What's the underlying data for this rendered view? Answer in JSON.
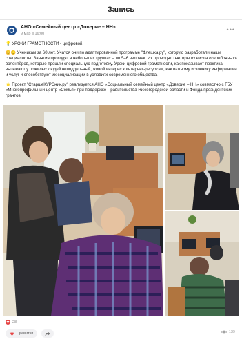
{
  "topbar": {
    "title": "Запись"
  },
  "post": {
    "org_name": "АНО «Семейный центр «Доверие – НН»",
    "date": "9 мар в 16:00",
    "heading": "УРОКИ ГРАМОТНОСТИ - цифровой.",
    "paragraph1": "Ученикам за 60 лет. Учатся они по адаптированной программе \"Флешка.ру\", которую разработали наши специалисты. Занятия проходят в небольших группах – по 5–6 человек. Их проводят тьюторы из числа «серебряных» волонтёров, которые прошли специальную подготовку. Уроки цифровой грамотности, как показывает практика, вызывают у пожилых людей неподдельный, живой интерес к интернет-ресурсам, как важному источнику информации и услуг и способствуют их социализации в условиях современного общества.",
    "paragraph2": "Проект \"СтаршеКУРСник.ру\" реализуется АНО «Социальный семейный центр «Доверие – НН» совместно с ГБУ «Многопрофильный центр «Семья» при поддержке Правительства Нижегородской области и Фонда президентских грантов."
  },
  "footer": {
    "likes_count": "28",
    "like_label": "Нравится",
    "views_count": "139"
  },
  "colors": {
    "accent": "#e64646",
    "brand": "#1f4f8f"
  }
}
